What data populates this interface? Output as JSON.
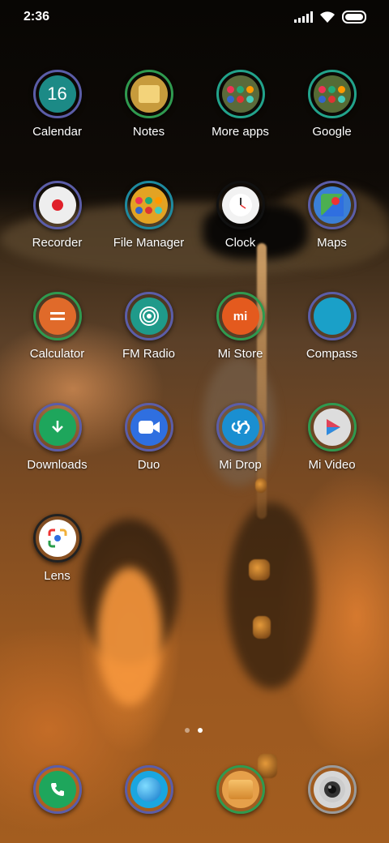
{
  "status_bar": {
    "time": "2:36"
  },
  "apps": [
    {
      "name": "Calendar",
      "label": "Calendar",
      "icon": "calendar-icon",
      "day": "16",
      "ring": "#5b5da8",
      "core": "#1c8a86"
    },
    {
      "name": "Notes",
      "label": "Notes",
      "icon": "notes-icon",
      "ring": "#2f9a4f",
      "core": "#c79b3c"
    },
    {
      "name": "More apps",
      "label": "More apps",
      "icon": "folder-icon",
      "ring": "#22a38b",
      "core": "#5a6a3a"
    },
    {
      "name": "Google",
      "label": "Google",
      "icon": "folder-icon",
      "ring": "#22a38b",
      "core": "#556b35"
    },
    {
      "name": "Recorder",
      "label": "Recorder",
      "icon": "record-icon",
      "ring": "#5b5da8",
      "core": "#eeeeee"
    },
    {
      "name": "File Manager",
      "label": "File Manager",
      "icon": "folder-icon",
      "ring": "#1e8aa0",
      "core": "#e3a323"
    },
    {
      "name": "Clock",
      "label": "Clock",
      "icon": "clock-icon",
      "ring": "#111111",
      "core": "#f2f2f2"
    },
    {
      "name": "Maps",
      "label": "Maps",
      "icon": "maps-icon",
      "ring": "#5b5da8",
      "core": "#3b7fd6"
    },
    {
      "name": "Calculator",
      "label": "Calculator",
      "icon": "calculator-icon",
      "ring": "#2f9a4f",
      "core": "#e06a2a"
    },
    {
      "name": "FM Radio",
      "label": "FM Radio",
      "icon": "radio-icon",
      "ring": "#5b5da8",
      "core": "#1f9a8a"
    },
    {
      "name": "Mi Store",
      "label": "Mi Store",
      "icon": "mi-store-icon",
      "ring": "#2f9a4f",
      "core": "#e45a1e"
    },
    {
      "name": "Compass",
      "label": "Compass",
      "icon": "compass-icon",
      "ring": "#5b5da8",
      "core": "#1aa0c8"
    },
    {
      "name": "Downloads",
      "label": "Downloads",
      "icon": "download-icon",
      "ring": "#5b5da8",
      "core": "#1ea65c"
    },
    {
      "name": "Duo",
      "label": "Duo",
      "icon": "video-call-icon",
      "ring": "#5b5da8",
      "core": "#2f6fe0"
    },
    {
      "name": "Mi Drop",
      "label": "Mi Drop",
      "icon": "mi-drop-icon",
      "ring": "#5b5da8",
      "core": "#1a8fd1"
    },
    {
      "name": "Mi Video",
      "label": "Mi Video",
      "icon": "play-icon",
      "ring": "#2f9a4f",
      "core": "#dddddd"
    },
    {
      "name": "Lens",
      "label": "Lens",
      "icon": "lens-icon",
      "ring": "#222222",
      "core": "#ffffff"
    }
  ],
  "dock": [
    {
      "name": "Phone",
      "icon": "phone-icon",
      "ring": "#5b5da8",
      "core": "#1ea65c"
    },
    {
      "name": "Browser",
      "icon": "browser-icon",
      "ring": "#5b5da8",
      "core": "#1aa6e0"
    },
    {
      "name": "Messages",
      "icon": "messages-icon",
      "ring": "#2f9a4f",
      "core": "#e6a04a"
    },
    {
      "name": "Camera",
      "icon": "camera-icon",
      "ring": "#9a9a9a",
      "core": "#d6d6d6"
    }
  ],
  "page_indicator": {
    "pages": 2,
    "current": 2
  }
}
